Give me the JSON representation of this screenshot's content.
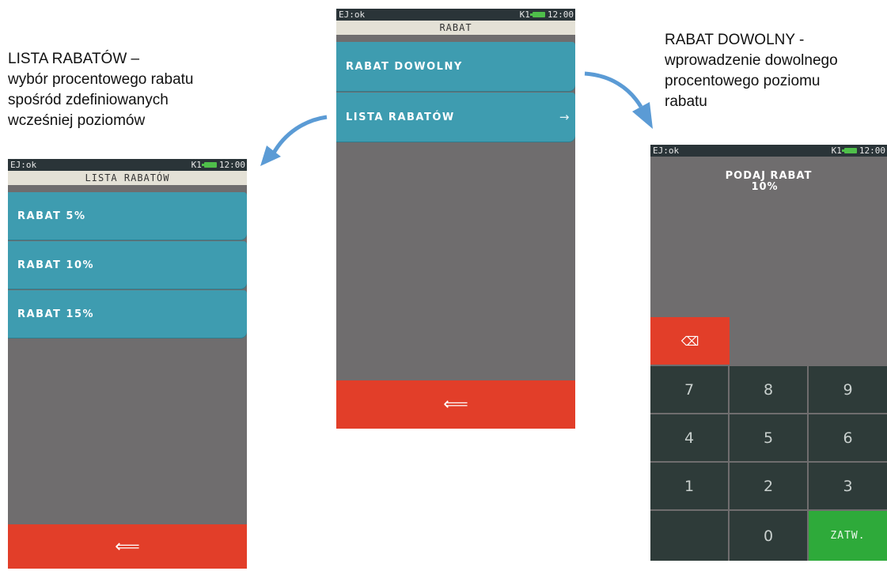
{
  "captions": {
    "left": "LISTA RABATÓW –\nwybór procentowego rabatu\nspośród zdefiniowanych\nwcześniej poziomów",
    "right": "RABAT DOWOLNY -\nwprowadzenie dowolnego\nprocentowego poziomu\nrabatu"
  },
  "colors": {
    "accent": "#3e9cb0",
    "back": "#e23e29",
    "confirm": "#2eaa3a",
    "keypad": "#2e3b39",
    "screen": "#6f6d6e"
  },
  "status": {
    "ej": "EJ:ok",
    "right": "K1",
    "time": "12:00"
  },
  "screen_center": {
    "title": "RABAT",
    "items": [
      {
        "label": "RABAT DOWOLNY"
      },
      {
        "label": "LISTA RABATÓW",
        "arrow": "→"
      }
    ],
    "back_icon": "⟸"
  },
  "screen_left": {
    "title": "LISTA RABATÓW",
    "items": [
      {
        "label": "RABAT 5%"
      },
      {
        "label": "RABAT 10%"
      },
      {
        "label": "RABAT 15%"
      }
    ],
    "back_icon": "⟸"
  },
  "screen_right": {
    "prompt_label": "PODAJ RABAT",
    "prompt_value": "10%",
    "delete_icon": "⌫",
    "keys": [
      "7",
      "8",
      "9",
      "4",
      "5",
      "6",
      "1",
      "2",
      "3",
      "",
      "0",
      "ZATW."
    ]
  },
  "icons": {
    "back": "return-arrow-icon",
    "delete": "backspace-icon",
    "battery": "battery-icon"
  }
}
